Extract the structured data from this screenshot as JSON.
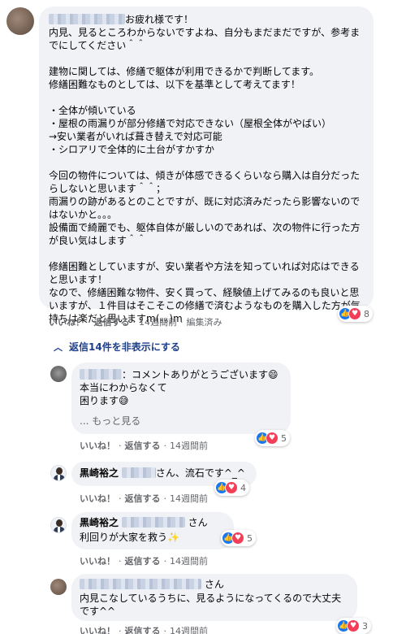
{
  "main_comment": {
    "greeting": "お疲れ様です！",
    "body": "内見、見るところわからないですよね、自分もまだまだですが、参考までにしてください＾＾\n\n建物に関しては、修繕で躯体が利用できるかで判断してます。\n修繕困難なものとしては、以下を基準として考えてます！\n\n・全体が傾いている\n・屋根の雨漏りが部分修繕で対応できない（屋根全体がやばい）\n→安い業者がいれば葺き替えで対応可能\n・シロアリで全体的に土台がすかすか\n\n今回の物件については、傾きが体感できるくらいなら購入は自分だったらしないと思います＾＾；\n雨漏りの跡があるとのことですが、既に対応済みだったら影響ないのではないかと。。。\n設備面で綺麗でも、躯体自体が厳しいのであれば、次の物件に行った方が良い気はします＾＾\n\n修繕困難としていますが、安い業者や方法を知っていれば対応はできると思います！\nなので、修繕困難な物件、安く買って、経験値上げてみるのも良いと思いますが、１件目はそこそこの修繕で済むようなものを購入した方が気持ちは楽だと思いますm(。。)m",
    "reaction_count": "8",
    "actions": {
      "like": "いいね！",
      "reply": "返信する",
      "time": "14週間前",
      "edited": "編集済み"
    }
  },
  "replies_toggle": "返信14件を非表示にする",
  "replies": [
    {
      "body_1": "：コメントありがとうございます😄",
      "body_2": "本当にわからなくて\n困ります😅",
      "see_more": "... もっと見る",
      "reaction_count": "5",
      "actions": {
        "like": "いいね！",
        "reply": "返信する",
        "time": "14週間前"
      }
    },
    {
      "name": "黒崎裕之",
      "body": "さん、流石です^_^",
      "reaction_count": "4",
      "actions": {
        "like": "いいね！",
        "reply": "返信する",
        "time": "14週間前"
      }
    },
    {
      "name": "黒崎裕之",
      "suffix": "さん",
      "body": "利回りが大家を救う✨",
      "reaction_count": "5",
      "actions": {
        "like": "いいね！",
        "reply": "返信する",
        "time": "14週間前"
      }
    },
    {
      "suffix": "さん",
      "body": "内見こなしているうちに、見るようになってくるので大丈夫です^^",
      "reaction_count": "3",
      "actions": {
        "like": "いいね！",
        "reply": "返信する",
        "time": "14週間前"
      }
    }
  ],
  "icons": {
    "like": "like-icon",
    "love": "love-icon",
    "chevron": "chevron-up-icon"
  },
  "colors": {
    "bubble": "#f0f2f5",
    "link": "#1c3f8a",
    "meta": "#65676b",
    "like": "#1877f2",
    "love": "#f33e58"
  }
}
